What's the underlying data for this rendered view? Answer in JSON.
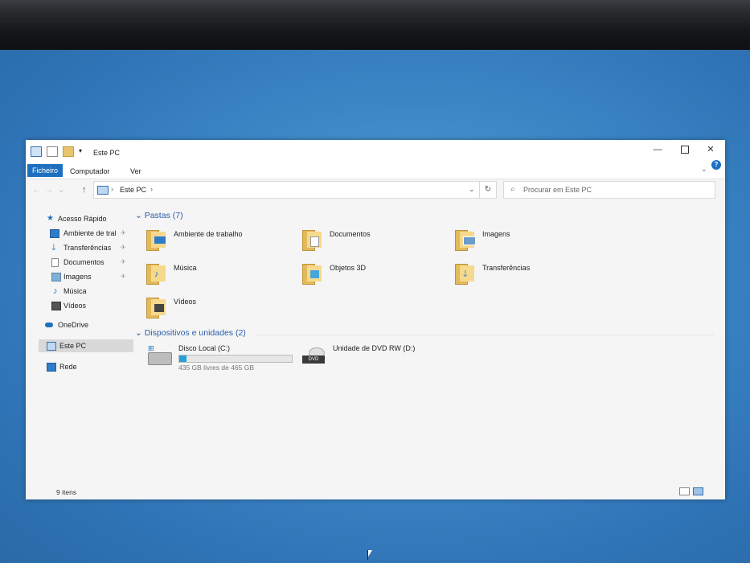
{
  "window": {
    "title": "Este PC",
    "minimize_glyph": "—",
    "close_glyph": "✕"
  },
  "ribbon": {
    "tabs": [
      "Ficheiro",
      "Computador",
      "Ver"
    ],
    "help_glyph": "?"
  },
  "address_bar": {
    "path_item": "Este PC",
    "separator": "›"
  },
  "search": {
    "placeholder": "Procurar em Este PC"
  },
  "sidebar": {
    "items": [
      {
        "label": "Acesso Rápido",
        "icon": "star-icon"
      },
      {
        "label": "Ambiente de tral",
        "icon": "desktop-icon",
        "pinned": true
      },
      {
        "label": "Transferências",
        "icon": "download-icon",
        "pinned": true
      },
      {
        "label": "Documentos",
        "icon": "document-icon",
        "pinned": true
      },
      {
        "label": "Imagens",
        "icon": "image-icon",
        "pinned": true
      },
      {
        "label": "Música",
        "icon": "music-icon"
      },
      {
        "label": "Vídeos",
        "icon": "video-icon"
      },
      {
        "label": "OneDrive",
        "icon": "cloud-icon"
      },
      {
        "label": "Este PC",
        "icon": "pc-icon",
        "selected": true
      },
      {
        "label": "Rede",
        "icon": "network-icon"
      }
    ]
  },
  "content": {
    "folders_header": "Pastas (7)",
    "folders": [
      {
        "label": "Ambiente de trabalho",
        "icon": "desktop-folder-icon"
      },
      {
        "label": "Documentos",
        "icon": "documents-folder-icon"
      },
      {
        "label": "Imagens",
        "icon": "images-folder-icon"
      },
      {
        "label": "Música",
        "icon": "music-folder-icon"
      },
      {
        "label": "Objetos 3D",
        "icon": "3d-objects-folder-icon"
      },
      {
        "label": "Transferências",
        "icon": "downloads-folder-icon"
      },
      {
        "label": "Vídeos",
        "icon": "videos-folder-icon"
      }
    ],
    "devices_header": "Dispositivos e unidades (2)",
    "drives": [
      {
        "label": "Disco Local (C:)",
        "space_text": "435 GB livres de 465 GB",
        "used_fraction": 0.065,
        "icon": "hard-drive-icon"
      },
      {
        "label": "Unidade de DVD RW (D:)",
        "icon": "dvd-drive-icon",
        "badge": "DVD"
      }
    ]
  },
  "status_bar": {
    "item_count": "9 itens"
  },
  "colors": {
    "accent": "#1e6fbf",
    "group_header": "#2a5caa",
    "drive_bar": "#26a0da"
  }
}
